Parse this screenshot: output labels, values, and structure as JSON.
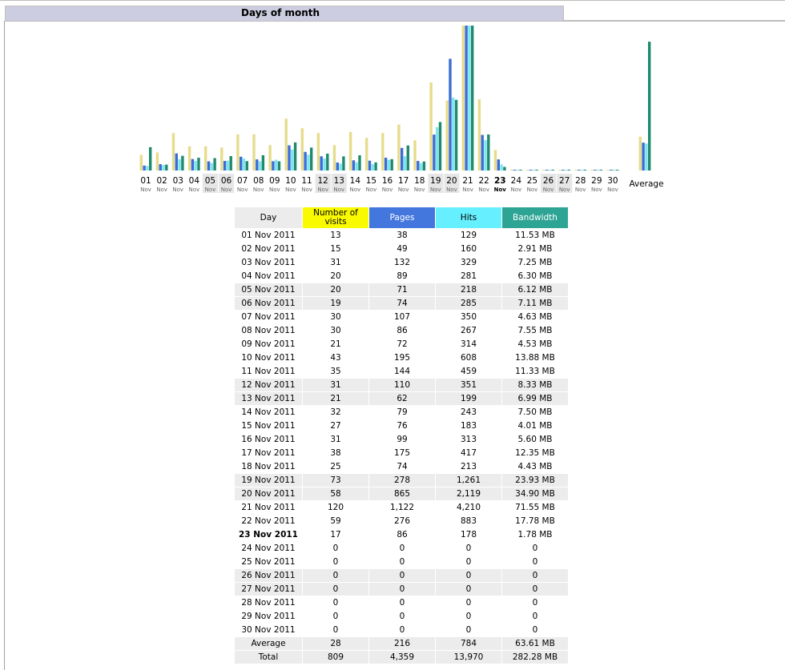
{
  "header": {
    "title": "Days of month"
  },
  "colors": {
    "visits": "#e6dc8c",
    "pages": "#3b6cd6",
    "hits": "#7ee4ee",
    "bandwidth": "#1f8a6d",
    "weekend_bg": "#e6e6e6"
  },
  "chart_data": {
    "type": "bar",
    "categories": [
      "01",
      "02",
      "03",
      "04",
      "05",
      "06",
      "07",
      "08",
      "09",
      "10",
      "11",
      "12",
      "13",
      "14",
      "15",
      "16",
      "17",
      "18",
      "19",
      "20",
      "21",
      "22",
      "23",
      "24",
      "25",
      "26",
      "27",
      "28",
      "29",
      "30"
    ],
    "month_label": "Nov",
    "weekend_days": [
      "05",
      "06",
      "12",
      "13",
      "19",
      "20",
      "26",
      "27"
    ],
    "current_day": "23",
    "series": [
      {
        "name": "Number of visits",
        "values": [
          13,
          15,
          31,
          20,
          20,
          19,
          30,
          30,
          21,
          43,
          35,
          31,
          21,
          32,
          27,
          31,
          38,
          25,
          73,
          58,
          120,
          59,
          17,
          0,
          0,
          0,
          0,
          0,
          0,
          0
        ]
      },
      {
        "name": "Pages",
        "values": [
          38,
          49,
          132,
          89,
          71,
          74,
          107,
          86,
          72,
          195,
          144,
          110,
          62,
          79,
          76,
          99,
          175,
          74,
          278,
          865,
          1122,
          276,
          86,
          0,
          0,
          0,
          0,
          0,
          0,
          0
        ]
      },
      {
        "name": "Hits",
        "values": [
          129,
          160,
          329,
          281,
          218,
          285,
          350,
          267,
          314,
          608,
          459,
          351,
          199,
          243,
          183,
          313,
          417,
          213,
          1261,
          2119,
          4210,
          883,
          178,
          0,
          0,
          0,
          0,
          0,
          0,
          0
        ]
      },
      {
        "name": "Bandwidth",
        "values": [
          11.53,
          2.91,
          7.25,
          6.3,
          6.12,
          7.11,
          4.63,
          7.55,
          4.53,
          13.88,
          11.33,
          8.33,
          6.99,
          7.5,
          4.01,
          5.6,
          12.35,
          4.43,
          23.93,
          34.9,
          71.55,
          17.78,
          1.78,
          0,
          0,
          0,
          0,
          0,
          0,
          0
        ]
      }
    ],
    "average": {
      "label": "Average",
      "values": [
        28,
        216,
        784,
        63.61
      ]
    }
  },
  "table": {
    "headers": {
      "day": "Day",
      "visits": "Number of visits",
      "pages": "Pages",
      "hits": "Hits",
      "bandwidth": "Bandwidth"
    },
    "rows": [
      {
        "day": "01 Nov 2011",
        "visits": "13",
        "pages": "38",
        "hits": "129",
        "bandwidth": "11.53 MB"
      },
      {
        "day": "02 Nov 2011",
        "visits": "15",
        "pages": "49",
        "hits": "160",
        "bandwidth": "2.91 MB"
      },
      {
        "day": "03 Nov 2011",
        "visits": "31",
        "pages": "132",
        "hits": "329",
        "bandwidth": "7.25 MB"
      },
      {
        "day": "04 Nov 2011",
        "visits": "20",
        "pages": "89",
        "hits": "281",
        "bandwidth": "6.30 MB"
      },
      {
        "day": "05 Nov 2011",
        "visits": "20",
        "pages": "71",
        "hits": "218",
        "bandwidth": "6.12 MB"
      },
      {
        "day": "06 Nov 2011",
        "visits": "19",
        "pages": "74",
        "hits": "285",
        "bandwidth": "7.11 MB"
      },
      {
        "day": "07 Nov 2011",
        "visits": "30",
        "pages": "107",
        "hits": "350",
        "bandwidth": "4.63 MB"
      },
      {
        "day": "08 Nov 2011",
        "visits": "30",
        "pages": "86",
        "hits": "267",
        "bandwidth": "7.55 MB"
      },
      {
        "day": "09 Nov 2011",
        "visits": "21",
        "pages": "72",
        "hits": "314",
        "bandwidth": "4.53 MB"
      },
      {
        "day": "10 Nov 2011",
        "visits": "43",
        "pages": "195",
        "hits": "608",
        "bandwidth": "13.88 MB"
      },
      {
        "day": "11 Nov 2011",
        "visits": "35",
        "pages": "144",
        "hits": "459",
        "bandwidth": "11.33 MB"
      },
      {
        "day": "12 Nov 2011",
        "visits": "31",
        "pages": "110",
        "hits": "351",
        "bandwidth": "8.33 MB"
      },
      {
        "day": "13 Nov 2011",
        "visits": "21",
        "pages": "62",
        "hits": "199",
        "bandwidth": "6.99 MB"
      },
      {
        "day": "14 Nov 2011",
        "visits": "32",
        "pages": "79",
        "hits": "243",
        "bandwidth": "7.50 MB"
      },
      {
        "day": "15 Nov 2011",
        "visits": "27",
        "pages": "76",
        "hits": "183",
        "bandwidth": "4.01 MB"
      },
      {
        "day": "16 Nov 2011",
        "visits": "31",
        "pages": "99",
        "hits": "313",
        "bandwidth": "5.60 MB"
      },
      {
        "day": "17 Nov 2011",
        "visits": "38",
        "pages": "175",
        "hits": "417",
        "bandwidth": "12.35 MB"
      },
      {
        "day": "18 Nov 2011",
        "visits": "25",
        "pages": "74",
        "hits": "213",
        "bandwidth": "4.43 MB"
      },
      {
        "day": "19 Nov 2011",
        "visits": "73",
        "pages": "278",
        "hits": "1,261",
        "bandwidth": "23.93 MB"
      },
      {
        "day": "20 Nov 2011",
        "visits": "58",
        "pages": "865",
        "hits": "2,119",
        "bandwidth": "34.90 MB"
      },
      {
        "day": "21 Nov 2011",
        "visits": "120",
        "pages": "1,122",
        "hits": "4,210",
        "bandwidth": "71.55 MB"
      },
      {
        "day": "22 Nov 2011",
        "visits": "59",
        "pages": "276",
        "hits": "883",
        "bandwidth": "17.78 MB"
      },
      {
        "day": "23 Nov 2011",
        "visits": "17",
        "pages": "86",
        "hits": "178",
        "bandwidth": "1.78 MB"
      },
      {
        "day": "24 Nov 2011",
        "visits": "0",
        "pages": "0",
        "hits": "0",
        "bandwidth": "0"
      },
      {
        "day": "25 Nov 2011",
        "visits": "0",
        "pages": "0",
        "hits": "0",
        "bandwidth": "0"
      },
      {
        "day": "26 Nov 2011",
        "visits": "0",
        "pages": "0",
        "hits": "0",
        "bandwidth": "0"
      },
      {
        "day": "27 Nov 2011",
        "visits": "0",
        "pages": "0",
        "hits": "0",
        "bandwidth": "0"
      },
      {
        "day": "28 Nov 2011",
        "visits": "0",
        "pages": "0",
        "hits": "0",
        "bandwidth": "0"
      },
      {
        "day": "29 Nov 2011",
        "visits": "0",
        "pages": "0",
        "hits": "0",
        "bandwidth": "0"
      },
      {
        "day": "30 Nov 2011",
        "visits": "0",
        "pages": "0",
        "hits": "0",
        "bandwidth": "0"
      }
    ],
    "highlight_rows": [
      4,
      5,
      11,
      12,
      18,
      19,
      25,
      26
    ],
    "current_row": 22,
    "summary": [
      {
        "day": "Average",
        "visits": "28",
        "pages": "216",
        "hits": "784",
        "bandwidth": "63.61 MB"
      },
      {
        "day": "Total",
        "visits": "809",
        "pages": "4,359",
        "hits": "13,970",
        "bandwidth": "282.28 MB"
      }
    ]
  }
}
